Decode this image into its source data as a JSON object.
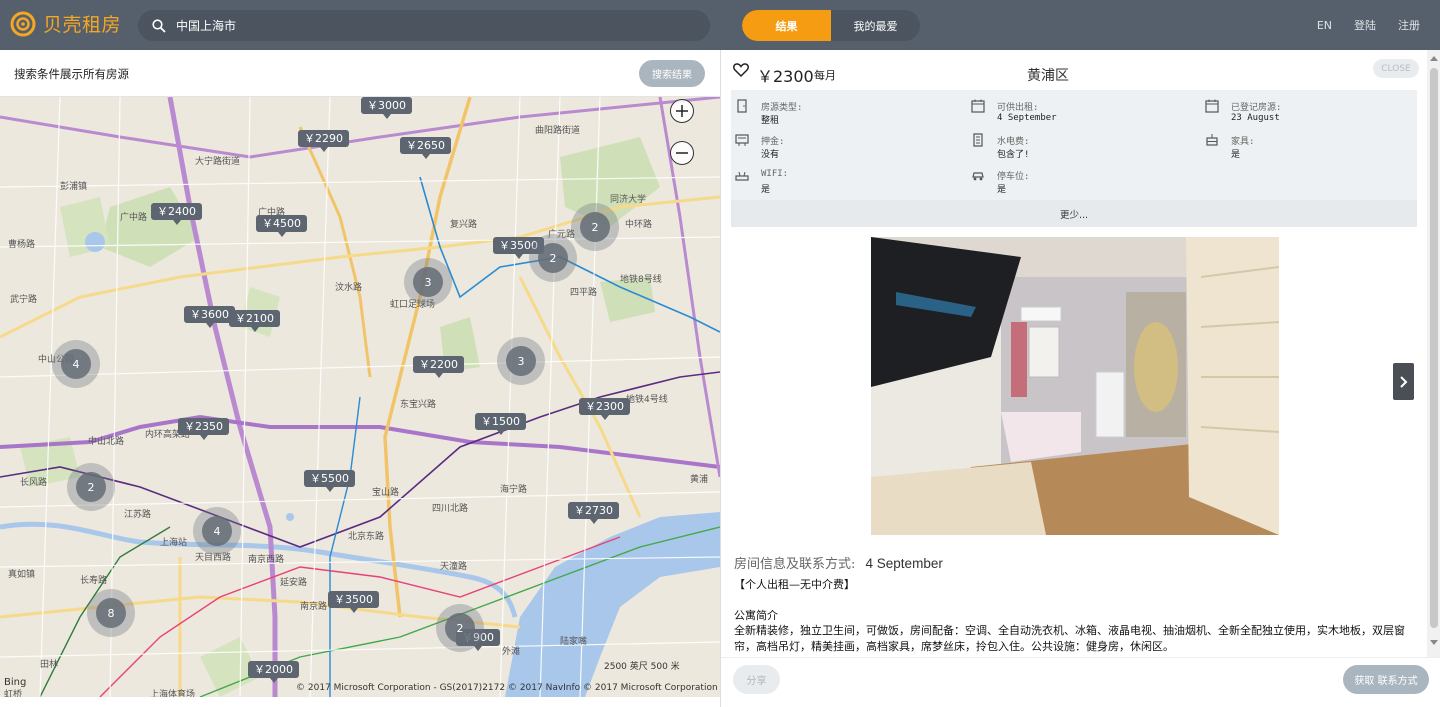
{
  "brand": {
    "name": "贝壳租房",
    "color": "#f5a623"
  },
  "search": {
    "value": "中国上海市"
  },
  "tabs": [
    {
      "label": "结果",
      "active": true
    },
    {
      "label": "我的最爱",
      "active": false
    }
  ],
  "top_links": [
    "EN",
    "登陆",
    "注册"
  ],
  "filter": {
    "text": "搜索条件展示所有房源",
    "button": "搜索结果"
  },
  "map": {
    "prices": [
      "￥3000",
      "￥2290",
      "￥2650",
      "￥2400",
      "￥4500",
      "￥3500",
      "￥3600",
      "￥2100",
      "￥2200",
      "￥2350",
      "￥1500",
      "￥2300",
      "￥5500",
      "￥2730",
      "￥3500",
      "￥900",
      "￥2000"
    ],
    "clusters": [
      "2",
      "2",
      "3",
      "3",
      "4",
      "2",
      "4",
      "8",
      "2"
    ],
    "labels": [
      "曲阳路街道",
      "大宁路街道",
      "彭浦镇",
      "广中路",
      "广中路",
      "汶水路",
      "四平路",
      "地铁8号线",
      "内环高架路",
      "中山北路",
      "地铁4号线",
      "上海站",
      "天目西路",
      "真如镇",
      "天潼路",
      "陆家嘴",
      "外滩",
      "黄浦",
      "宝山路",
      "东宝兴路",
      "中山公园",
      "长寿路",
      "武宁路",
      "曹杨路",
      "广元路",
      "中环路",
      "复兴路",
      "同济大学",
      "长风路",
      "虹口足球场",
      "四川北路",
      "海宁路",
      "北京东路",
      "南京路",
      "延安路",
      "南京西路",
      "上海体育场",
      "田林",
      "虹桥",
      "江苏路"
    ],
    "attribution": "© 2017 Microsoft Corporation - GS(2017)2172 © 2017 NavInfo © 2017 Microsoft Corporation Terms",
    "scale": "2500 英尺     500 米",
    "bing": "Bing"
  },
  "detail": {
    "price": "￥2300",
    "price_unit": "每月",
    "district": "黄浦区",
    "close": "CLOSE",
    "info": [
      {
        "icon": "door-icon",
        "key": "房源类型:",
        "value": "整租"
      },
      {
        "icon": "calendar-icon",
        "key": "可供出租:",
        "value": "4 September"
      },
      {
        "icon": "calendar-icon",
        "key": "已登记房源:",
        "value": "23 August"
      },
      {
        "icon": "deposit-icon",
        "key": "押金:",
        "value": "没有"
      },
      {
        "icon": "bill-icon",
        "key": "水电费:",
        "value": "包含了!"
      },
      {
        "icon": "furniture-icon",
        "key": "家具:",
        "value": "是"
      },
      {
        "icon": "wifi-icon",
        "key": "WIFI:",
        "value": "是"
      },
      {
        "icon": "parking-icon",
        "key": "停车位:",
        "value": "是"
      }
    ],
    "more": "更少...",
    "contact_label": "房间信息及联系方式:",
    "contact_date": "4 September",
    "desc_line1": "【个人出租—无中介费】",
    "desc_line2": "公寓简介",
    "desc_body": "全新精装修，独立卫生间，可做饭，房间配备：空调、全自动洗衣机、冰箱、液晶电视、抽油烟机、全新全配独立使用，实木地板，双层窗帘，高档吊灯，精美挂画，高档家具，席梦丝床，拎包入住。公共设施：健身房，休闲区。",
    "share": "分享",
    "contact_button": "获取 联系方式"
  }
}
